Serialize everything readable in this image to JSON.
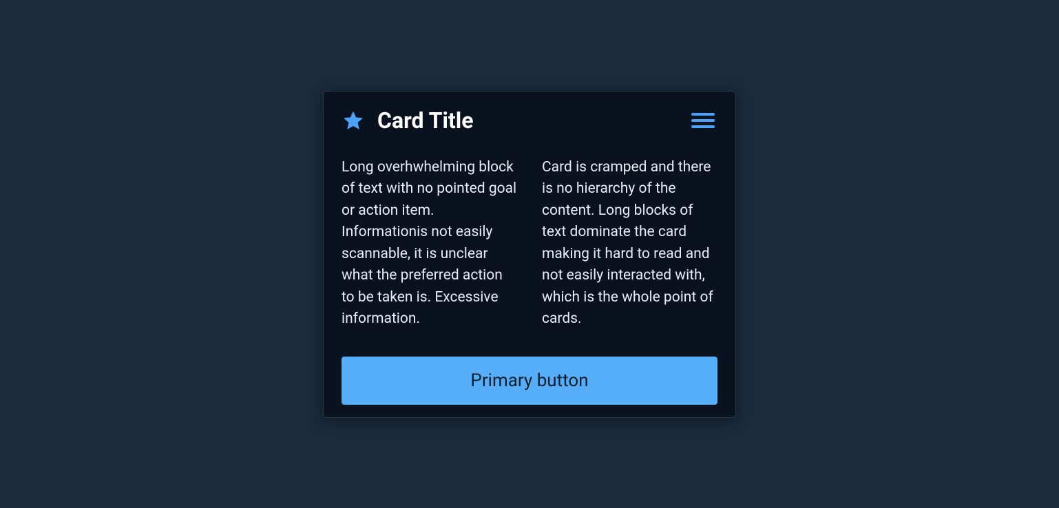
{
  "card": {
    "title": "Card Title",
    "body": {
      "column1": "Long overhwhelming block of text with no pointed goal or action item. Informationis not easily scannable, it is unclear what the preferred action to be taken is. Excessive information.",
      "column2": "Card is cramped and there is no hierarchy of the content. Long blocks of text dominate the card making it hard to read and not easily interacted with, which is the whole point of cards."
    },
    "primary_button_label": "Primary button"
  },
  "icons": {
    "star": "star-icon",
    "menu": "hamburger-menu-icon"
  },
  "colors": {
    "accent": "#4aa3f7",
    "button": "#56aef8",
    "background": "#1a2b3d",
    "card_background": "#0a1220"
  }
}
